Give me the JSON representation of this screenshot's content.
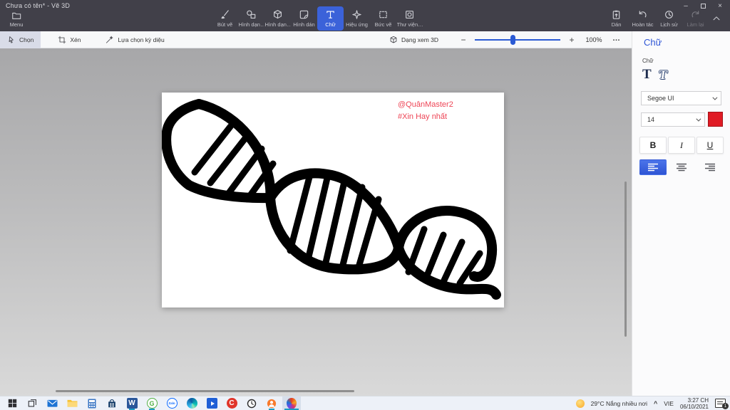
{
  "window": {
    "title": "Chưa có tên* - Vẽ 3D",
    "controls": {
      "minimize": "–",
      "close": "×"
    }
  },
  "top_toolbar": {
    "menu_label": "Menu",
    "tools": [
      {
        "label": "Bút vẽ",
        "icon": "paintbrush-icon",
        "selected": false
      },
      {
        "label": "Hình dạn…",
        "icon": "shapes-2d-icon",
        "selected": false
      },
      {
        "label": "Hình dạn…",
        "icon": "shapes-3d-icon",
        "selected": false
      },
      {
        "label": "Hình dán",
        "icon": "sticker-icon",
        "selected": false
      },
      {
        "label": "Chữ",
        "icon": "text-icon",
        "selected": true
      },
      {
        "label": "Hiệu ứng",
        "icon": "effects-icon",
        "selected": false
      },
      {
        "label": "Bức vẽ",
        "icon": "canvas-icon",
        "selected": false
      },
      {
        "label": "Thư viện…",
        "icon": "library-icon",
        "selected": false
      }
    ],
    "right_tools": [
      {
        "label": "Dán",
        "icon": "paste-icon",
        "disabled": false
      },
      {
        "label": "Hoàn tác",
        "icon": "undo-icon",
        "disabled": false
      },
      {
        "label": "Lịch sử",
        "icon": "history-icon",
        "disabled": false
      },
      {
        "label": "Làm lại",
        "icon": "redo-icon",
        "disabled": true
      }
    ]
  },
  "second_toolbar": {
    "select_label": "Chọn",
    "crop_label": "Xén",
    "magic_label": "Lựa chọn kỳ diệu",
    "view3d_label": "Dạng xem 3D",
    "zoom_out": "−",
    "zoom_in": "+",
    "zoom_level": "100%",
    "more_label": "…"
  },
  "side_panel": {
    "header": "Chữ",
    "section_label": "Chữ",
    "text_2d_glyph": "T",
    "text_3d_glyph": "T",
    "font_name": "Segoe UI",
    "font_size": "14",
    "swatch_color": "#e01b24",
    "bold_label": "B",
    "italic_label": "I",
    "underline_label": "U"
  },
  "canvas": {
    "line1": "@QuânMaster2",
    "line2": "#Xin Hay nhất",
    "text_color": "#ee4556"
  },
  "taskbar": {
    "icons": [
      {
        "name": "start"
      },
      {
        "name": "task-view"
      },
      {
        "name": "mail"
      },
      {
        "name": "file-explorer"
      },
      {
        "name": "calculator"
      },
      {
        "name": "microsoft-store"
      },
      {
        "name": "word",
        "glyph": "W",
        "running": true
      },
      {
        "name": "green-app",
        "glyph": "G",
        "running": true
      },
      {
        "name": "zalo",
        "glyph": "Zalo",
        "running": false
      },
      {
        "name": "edge"
      },
      {
        "name": "movies-tv"
      },
      {
        "name": "ccleaner",
        "glyph": "C"
      },
      {
        "name": "alarms-clock"
      },
      {
        "name": "orange-app",
        "running": true
      },
      {
        "name": "paint-3d",
        "running": true,
        "active": true
      }
    ],
    "tray": {
      "weather": "29°C Nắng nhiều nơi",
      "expand": "^",
      "language": "VIE",
      "time": "3:27 CH",
      "date": "06/10/2021",
      "badge": "1"
    }
  }
}
